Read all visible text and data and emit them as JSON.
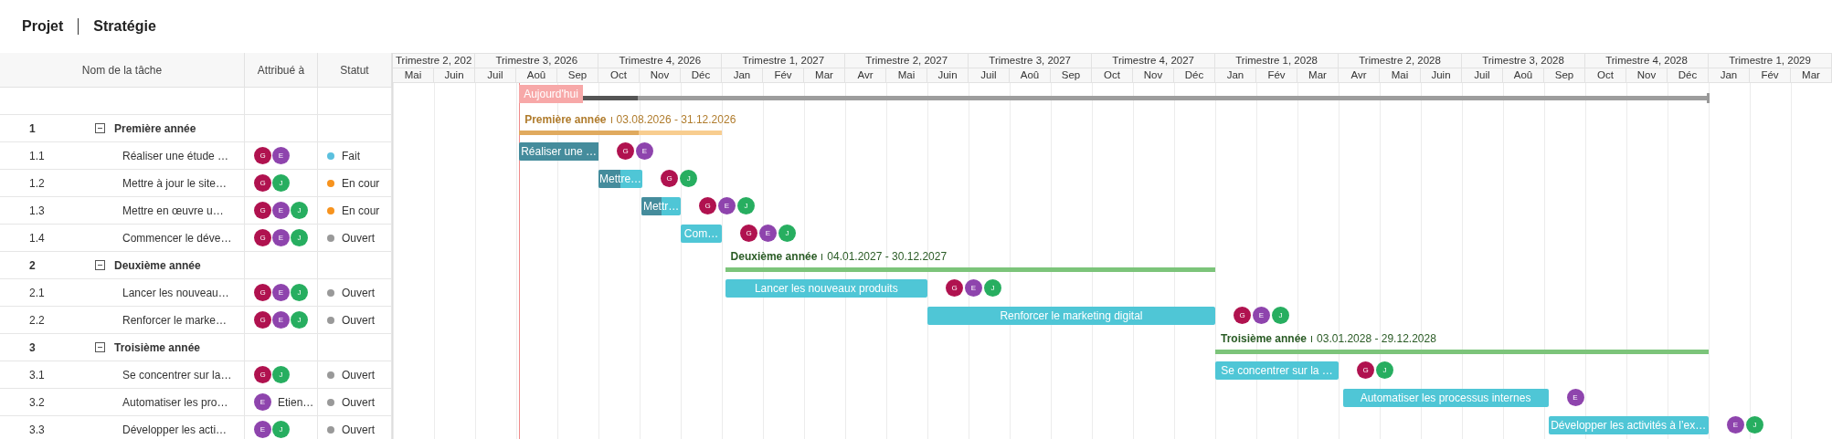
{
  "breadcrumb": [
    "Projet",
    "Stratégie"
  ],
  "table": {
    "columns": [
      "Nom de la tâche",
      "Attribué à",
      "Statut"
    ]
  },
  "timeline": {
    "quarters": [
      {
        "label": "Trimestre 2, 202",
        "months": [
          "Mai",
          "Juin"
        ]
      },
      {
        "label": "Trimestre 3, 2026",
        "months": [
          "Juil",
          "Aoû",
          "Sep"
        ]
      },
      {
        "label": "Trimestre 4, 2026",
        "months": [
          "Oct",
          "Nov",
          "Déc"
        ]
      },
      {
        "label": "Trimestre 1, 2027",
        "months": [
          "Jan",
          "Fév",
          "Mar"
        ]
      },
      {
        "label": "Trimestre 2, 2027",
        "months": [
          "Avr",
          "Mai",
          "Juin"
        ]
      },
      {
        "label": "Trimestre 3, 2027",
        "months": [
          "Juil",
          "Aoû",
          "Sep"
        ]
      },
      {
        "label": "Trimestre 4, 2027",
        "months": [
          "Oct",
          "Nov",
          "Déc"
        ]
      },
      {
        "label": "Trimestre 1, 2028",
        "months": [
          "Jan",
          "Fév",
          "Mar"
        ]
      },
      {
        "label": "Trimestre 2, 2028",
        "months": [
          "Avr",
          "Mai",
          "Juin"
        ]
      },
      {
        "label": "Trimestre 3, 2028",
        "months": [
          "Juil",
          "Aoû",
          "Sep"
        ]
      },
      {
        "label": "Trimestre 4, 2028",
        "months": [
          "Oct",
          "Nov",
          "Déc"
        ]
      },
      {
        "label": "Trimestre 1, 2029",
        "months": [
          "Jan",
          "Fév",
          "Mar"
        ]
      }
    ],
    "today": "Aujourd'hui",
    "project": {
      "level": 0.1
    }
  },
  "groups": [
    {
      "number": "1",
      "title": "Première année",
      "expanded": true,
      "chart_title": "Première année",
      "dates": "03.08.2026 - 31.12.2026",
      "kind": "active",
      "level": 0.59,
      "tasks": [
        {
          "number": "1.1",
          "name": "Réaliser une étude …",
          "assignees": [
            {
              "initial": "G",
              "color": "#b0124f"
            },
            {
              "initial": "E",
              "color": "#8e44ad"
            }
          ],
          "status": {
            "label": "Fait",
            "color": "#5bc0de"
          },
          "bar": {
            "label": "Réaliser une …",
            "level": 1,
            "assignees": [
              {
                "initial": "G",
                "color": "#b0124f"
              },
              {
                "initial": "E",
                "color": "#8e44ad"
              }
            ]
          }
        },
        {
          "number": "1.2",
          "name": "Mettre à jour le site…",
          "assignees": [
            {
              "initial": "G",
              "color": "#b0124f"
            },
            {
              "initial": "J",
              "color": "#27ae60"
            }
          ],
          "status": {
            "label": "En cour",
            "color": "#f7931e"
          },
          "bar": {
            "label": "Mettre…",
            "level": 0.5,
            "assignees": [
              {
                "initial": "G",
                "color": "#b0124f"
              },
              {
                "initial": "J",
                "color": "#27ae60"
              }
            ]
          }
        },
        {
          "number": "1.3",
          "name": "Mettre en œuvre u…",
          "assignees": [
            {
              "initial": "G",
              "color": "#b0124f"
            },
            {
              "initial": "E",
              "color": "#8e44ad"
            },
            {
              "initial": "J",
              "color": "#27ae60"
            }
          ],
          "status": {
            "label": "En cour",
            "color": "#f7931e"
          },
          "bar": {
            "label": "Mettr…",
            "level": 0.5,
            "assignees": [
              {
                "initial": "G",
                "color": "#b0124f"
              },
              {
                "initial": "E",
                "color": "#8e44ad"
              },
              {
                "initial": "J",
                "color": "#27ae60"
              }
            ]
          }
        },
        {
          "number": "1.4",
          "name": "Commencer le déve…",
          "assignees": [
            {
              "initial": "G",
              "color": "#b0124f"
            },
            {
              "initial": "E",
              "color": "#8e44ad"
            },
            {
              "initial": "J",
              "color": "#27ae60"
            }
          ],
          "status": {
            "label": "Ouvert",
            "color": "#999999"
          },
          "bar": {
            "label": "Com…",
            "level": 0,
            "assignees": [
              {
                "initial": "G",
                "color": "#b0124f"
              },
              {
                "initial": "E",
                "color": "#8e44ad"
              },
              {
                "initial": "J",
                "color": "#27ae60"
              }
            ]
          }
        }
      ]
    },
    {
      "number": "2",
      "title": "Deuxième année",
      "expanded": true,
      "chart_title": "Deuxième année",
      "dates": "04.01.2027 - 30.12.2027",
      "kind": "planned",
      "level": 0,
      "tasks": [
        {
          "number": "2.1",
          "name": "Lancer les nouveau…",
          "assignees": [
            {
              "initial": "G",
              "color": "#b0124f"
            },
            {
              "initial": "E",
              "color": "#8e44ad"
            },
            {
              "initial": "J",
              "color": "#27ae60"
            }
          ],
          "status": {
            "label": "Ouvert",
            "color": "#999999"
          },
          "bar": {
            "label": "Lancer les nouveaux produits",
            "level": 0,
            "assignees": [
              {
                "initial": "G",
                "color": "#b0124f"
              },
              {
                "initial": "E",
                "color": "#8e44ad"
              },
              {
                "initial": "J",
                "color": "#27ae60"
              }
            ]
          }
        },
        {
          "number": "2.2",
          "name": "Renforcer le marke…",
          "assignees": [
            {
              "initial": "G",
              "color": "#b0124f"
            },
            {
              "initial": "E",
              "color": "#8e44ad"
            },
            {
              "initial": "J",
              "color": "#27ae60"
            }
          ],
          "status": {
            "label": "Ouvert",
            "color": "#999999"
          },
          "bar": {
            "label": "Renforcer le marketing digital",
            "level": 0,
            "assignees": [
              {
                "initial": "G",
                "color": "#b0124f"
              },
              {
                "initial": "E",
                "color": "#8e44ad"
              },
              {
                "initial": "J",
                "color": "#27ae60"
              }
            ]
          }
        }
      ]
    },
    {
      "number": "3",
      "title": "Troisième année",
      "expanded": true,
      "chart_title": "Troisième année",
      "dates": "03.01.2028 - 29.12.2028",
      "kind": "planned",
      "level": 0,
      "tasks": [
        {
          "number": "3.1",
          "name": "Se concentrer sur la…",
          "assignees": [
            {
              "initial": "G",
              "color": "#b0124f"
            },
            {
              "initial": "J",
              "color": "#27ae60"
            }
          ],
          "status": {
            "label": "Ouvert",
            "color": "#999999"
          },
          "bar": {
            "label": "Se concentrer sur la …",
            "level": 0,
            "assignees": [
              {
                "initial": "G",
                "color": "#b0124f"
              },
              {
                "initial": "J",
                "color": "#27ae60"
              }
            ]
          }
        },
        {
          "number": "3.2",
          "name": "Automatiser les pro…",
          "assignees": [
            {
              "initial": "E",
              "color": "#8e44ad"
            }
          ],
          "assignee_name": "Etien…",
          "status": {
            "label": "Ouvert",
            "color": "#999999"
          },
          "bar": {
            "label": "Automatiser les processus internes",
            "level": 0,
            "assignees": [
              {
                "initial": "E",
                "color": "#8e44ad"
              }
            ]
          }
        },
        {
          "number": "3.3",
          "name": "Développer les acti…",
          "assignees": [
            {
              "initial": "E",
              "color": "#8e44ad"
            },
            {
              "initial": "J",
              "color": "#27ae60"
            }
          ],
          "status": {
            "label": "Ouvert",
            "color": "#999999"
          },
          "bar": {
            "label": "Développer les activités à l’ex…",
            "level": 0,
            "assignees": [
              {
                "initial": "E",
                "color": "#8e44ad"
              },
              {
                "initial": "J",
                "color": "#27ae60"
              }
            ]
          }
        }
      ]
    }
  ]
}
